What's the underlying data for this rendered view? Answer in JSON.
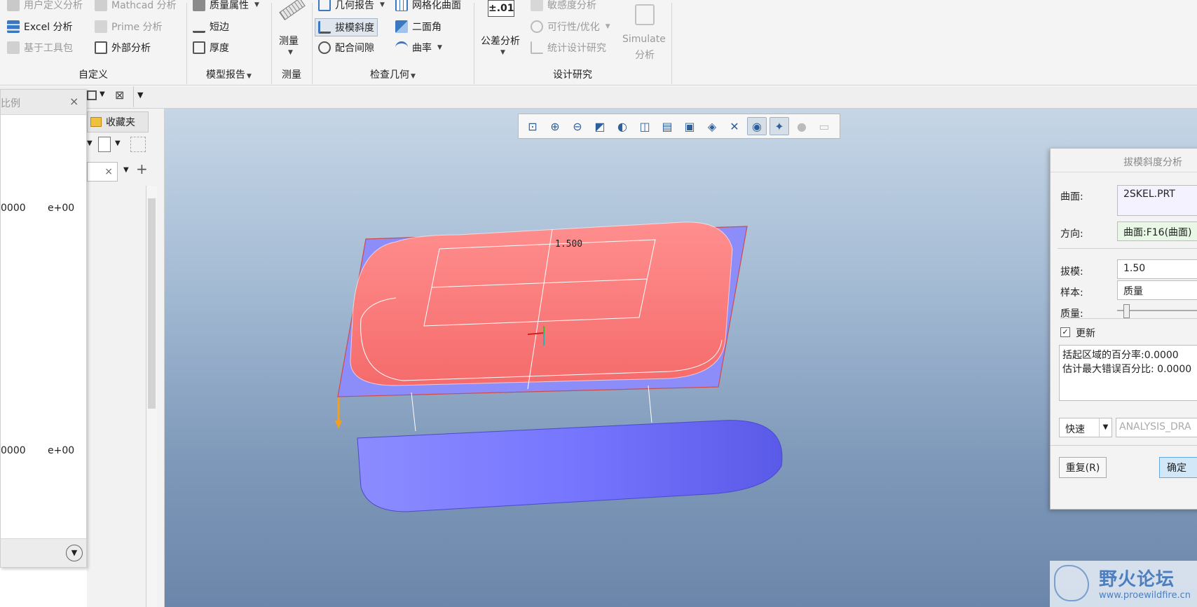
{
  "ribbon": {
    "col1": {
      "row1": "用户定义分析",
      "row2": "Excel 分析",
      "row3": "基于工具包"
    },
    "col2": {
      "row1": "Mathcad 分析",
      "row2": "Prime 分析",
      "row3": "外部分析"
    },
    "col3": {
      "row1": "质量属性",
      "row2": "短边",
      "row3": "厚度"
    },
    "measure": {
      "label": "测量"
    },
    "col5": {
      "row1": "几何报告",
      "row2": "拔模斜度",
      "row3": "配合间隙"
    },
    "col6": {
      "row1": "网格化曲面",
      "row2": "二面角",
      "row3": "曲率"
    },
    "tolerance": {
      "symbol": "±.01",
      "label": "公差分析"
    },
    "col8": {
      "row1": "敏感度分析",
      "row2": "可行性/优化",
      "row3": "统计设计研究"
    },
    "simulate": {
      "line1": "Simulate",
      "line2": "分析"
    },
    "groups": {
      "custom": "自定义",
      "model_report": "模型报告",
      "measure": "测量",
      "check_geometry": "检查几何",
      "design_study": "设计研究"
    }
  },
  "left_panel": {
    "title": "比例",
    "favorites": "收藏夹",
    "row1_value": "0000",
    "row1_exp": "e+00",
    "row2_value": "0000",
    "row2_exp": "e+00"
  },
  "viewport": {
    "dimension_label": "1.500"
  },
  "dialog": {
    "title": "拔模斜度分析",
    "surface_label": "曲面:",
    "surface_value": "2SKEL.PRT",
    "direction_label": "方向:",
    "direction_value": "曲面:F16(曲面)",
    "draft_label": "拔模:",
    "draft_value": "1.50",
    "sample_label": "样本:",
    "sample_value": "质量",
    "quality_label": "质量:",
    "update_label": "更新",
    "result_line1": "括起区域的百分率:0.0000",
    "result_line2": "估计最大错误百分比: 0.0000",
    "mode_value": "快速",
    "name_value": "ANALYSIS_DRA",
    "repeat_button": "重复(R)",
    "ok_button": "确定"
  },
  "watermark": {
    "title": "野火论坛",
    "url": "www.proewildfire.cn"
  },
  "colors": {
    "part_top": "#ff7b7b",
    "part_side": "#7d7dff",
    "plane": "#8d8dfa",
    "background_top": "#c6d6e6",
    "background_bottom": "#6b86aa"
  }
}
